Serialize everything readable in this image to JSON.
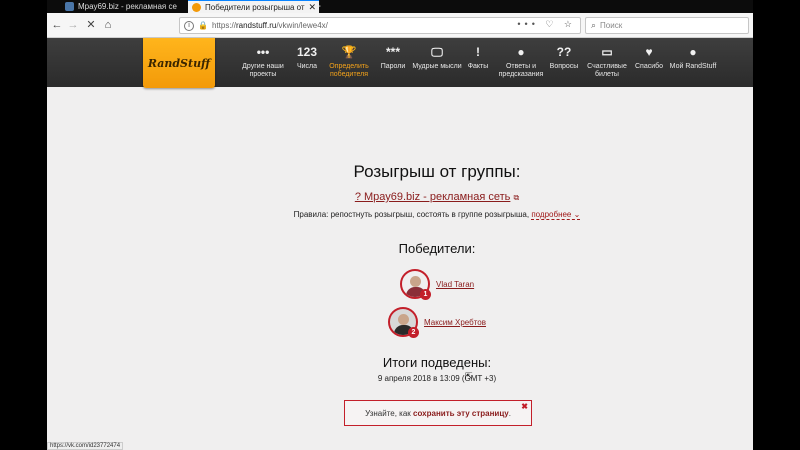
{
  "browser": {
    "tabs": [
      {
        "label": "Мрау69.biz - рекламная се"
      },
      {
        "label": "Победители розыгрыша от гр"
      }
    ],
    "newtab_label": "+",
    "url_host_prefix": "https://",
    "url_host": "randstuff.ru",
    "url_path": "/vkwin/lewe4x/",
    "url_icons": "••• ♡ ☆",
    "search_placeholder": "Поиск",
    "status_url": "https://vk.com/id23772474"
  },
  "site": {
    "logo": "RandStuff",
    "menu": [
      {
        "icon": "•••",
        "label": "Другие наши проекты"
      },
      {
        "icon": "123",
        "label": "Числа"
      },
      {
        "icon": "🏆",
        "label": "Определить победителя"
      },
      {
        "icon": "***",
        "label": "Пароли"
      },
      {
        "icon": "🖵",
        "label": "Мудрые мысли"
      },
      {
        "icon": "!",
        "label": "Факты"
      },
      {
        "icon": "●",
        "label": "Ответы и предсказания"
      },
      {
        "icon": "??",
        "label": "Вопросы"
      },
      {
        "icon": "▭",
        "label": "Счастливые билеты"
      },
      {
        "icon": "♥",
        "label": "Спасибо"
      },
      {
        "icon": "●",
        "label": "Мой RandStuff"
      }
    ]
  },
  "main": {
    "title": "Розыгрыш от группы:",
    "group_link": "? Мрау69.biz - рекламная сеть",
    "group_link_icon": "⧉",
    "rules_text": "Правила: репостнуть розыгрыш, состоять в группе розыгрыша,",
    "rules_more": "подробнее",
    "rules_more_icon": "⌄",
    "winners_title": "Победители:",
    "winners": [
      {
        "rank": "1",
        "name": "Vlad Taran"
      },
      {
        "rank": "2",
        "name": "Максим Хребтов"
      }
    ],
    "results_title": "Итоги подведены:",
    "results_date": "9 апреля 2018 в 13:09 (GMT +3)",
    "save_notice_prefix": "Узнайте, как",
    "save_notice_link": "сохранить эту страницу",
    "save_notice_suffix": ".",
    "save_notice_close": "✖"
  },
  "colors": {
    "accent": "#c31f2a",
    "logo": "#f39a09",
    "link": "#8a1c1c",
    "header": "#333333"
  }
}
